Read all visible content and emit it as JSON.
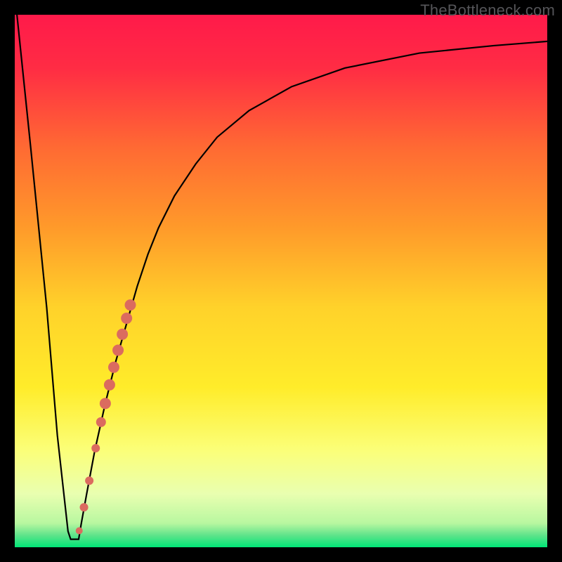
{
  "attribution": "TheBottleneck.com",
  "colors": {
    "frame": "#000000",
    "gradient_stops": [
      {
        "offset": 0.0,
        "color": "#ff1a4a"
      },
      {
        "offset": 0.1,
        "color": "#ff2c44"
      },
      {
        "offset": 0.25,
        "color": "#ff6a33"
      },
      {
        "offset": 0.4,
        "color": "#ff9a2a"
      },
      {
        "offset": 0.55,
        "color": "#ffd22a"
      },
      {
        "offset": 0.7,
        "color": "#ffec2a"
      },
      {
        "offset": 0.82,
        "color": "#fbff7a"
      },
      {
        "offset": 0.9,
        "color": "#e9ffb0"
      },
      {
        "offset": 0.955,
        "color": "#b8f7a0"
      },
      {
        "offset": 0.978,
        "color": "#5de38a"
      },
      {
        "offset": 1.0,
        "color": "#00e777"
      }
    ],
    "curve": "#000000",
    "markers": "#db6b5f"
  },
  "chart_data": {
    "type": "line",
    "title": "",
    "xlabel": "",
    "ylabel": "",
    "xlim": [
      0,
      100
    ],
    "ylim": [
      0,
      100
    ],
    "series": [
      {
        "name": "bottleneck-curve",
        "x": [
          0,
          3,
          6,
          8,
          10,
          10.5,
          12,
          12.5,
          13.5,
          15,
          17,
          19,
          21,
          23,
          25,
          27,
          30,
          34,
          38,
          44,
          52,
          62,
          76,
          90,
          100
        ],
        "y": [
          104,
          75,
          45,
          21,
          3,
          1.5,
          1.5,
          4.5,
          10,
          18,
          27,
          35,
          42,
          49,
          55,
          60,
          66,
          72,
          77,
          82,
          86.5,
          90,
          92.8,
          94.2,
          95
        ]
      }
    ],
    "markers": {
      "name": "highlighted-range",
      "points": [
        {
          "x": 12.1,
          "y": 3.1,
          "r": 5
        },
        {
          "x": 13.0,
          "y": 7.5,
          "r": 6
        },
        {
          "x": 14.0,
          "y": 12.5,
          "r": 6
        },
        {
          "x": 15.2,
          "y": 18.6,
          "r": 6
        },
        {
          "x": 16.2,
          "y": 23.5,
          "r": 7
        },
        {
          "x": 17.0,
          "y": 27.0,
          "r": 8
        },
        {
          "x": 17.8,
          "y": 30.5,
          "r": 8
        },
        {
          "x": 18.6,
          "y": 33.8,
          "r": 8
        },
        {
          "x": 19.4,
          "y": 37.0,
          "r": 8
        },
        {
          "x": 20.2,
          "y": 40.0,
          "r": 8
        },
        {
          "x": 21.0,
          "y": 43.0,
          "r": 8
        },
        {
          "x": 21.7,
          "y": 45.5,
          "r": 8
        }
      ]
    }
  }
}
